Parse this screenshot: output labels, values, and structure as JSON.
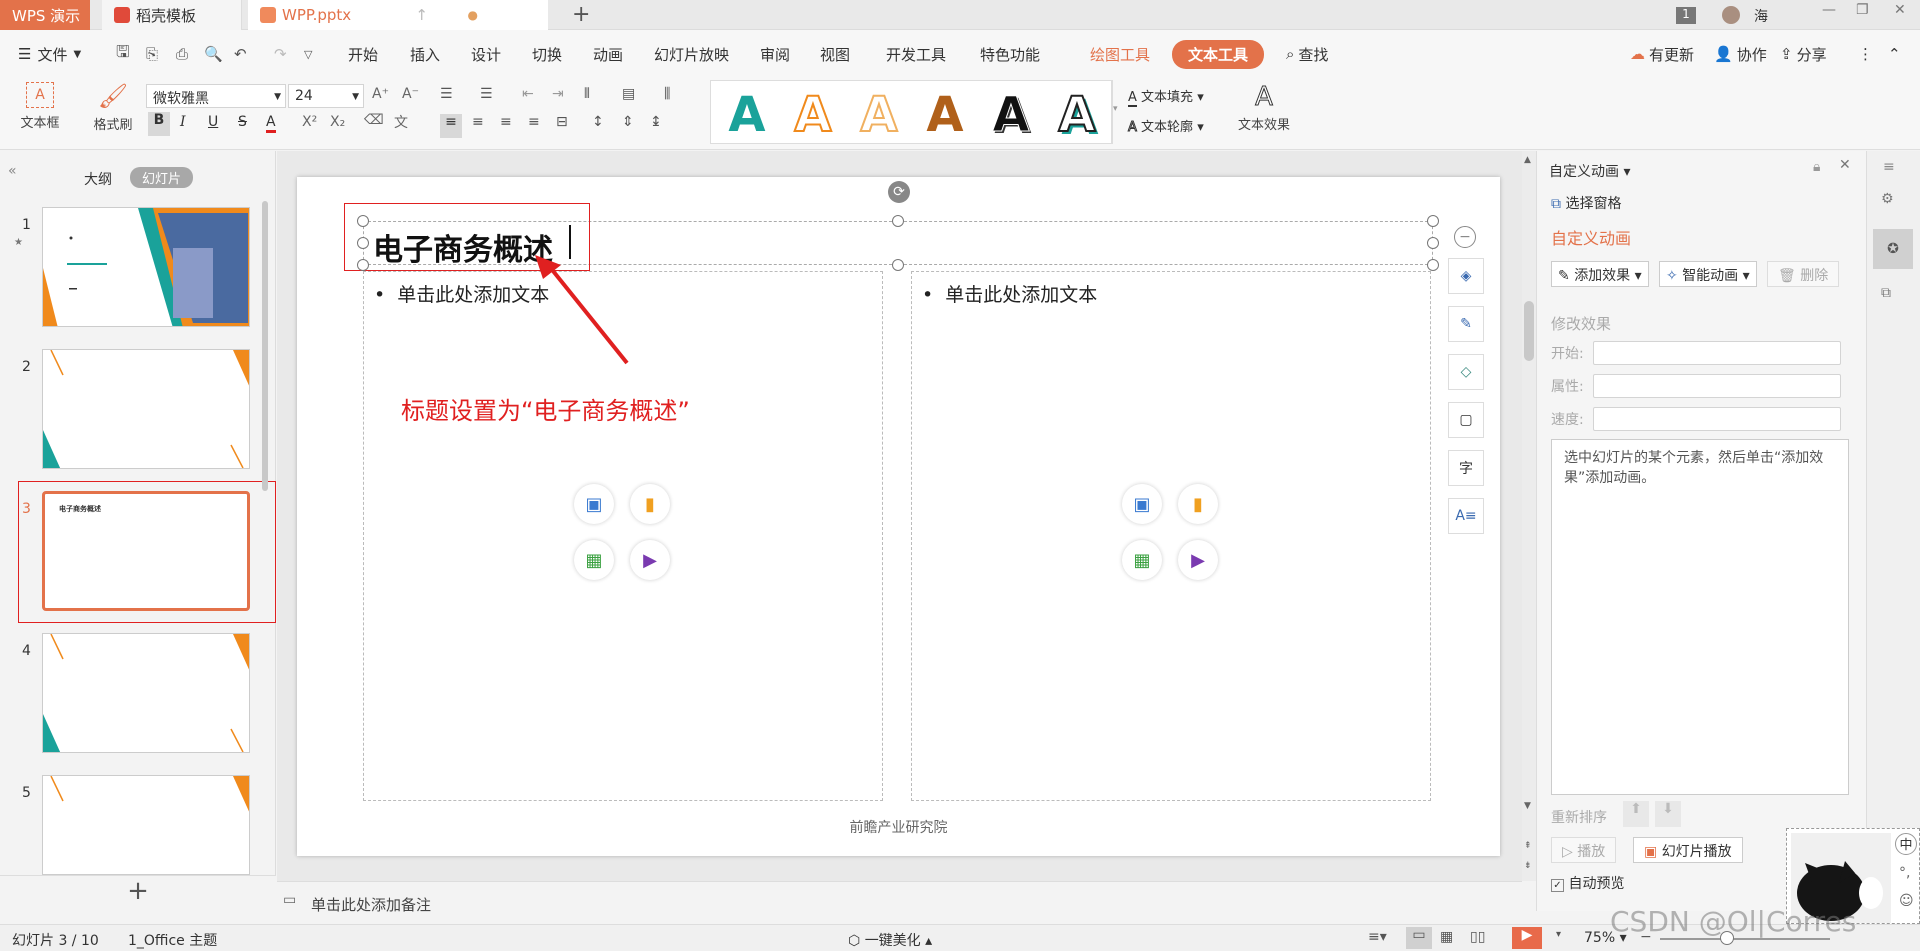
{
  "tabs": {
    "app": "WPS 演示",
    "template": "稻壳模板",
    "document": "WPP.pptx",
    "new_tab": "+"
  },
  "window": {
    "badge": "1",
    "user": "海"
  },
  "menu": {
    "file": "文件",
    "items": [
      "开始",
      "插入",
      "设计",
      "切换",
      "动画",
      "幻灯片放映",
      "审阅",
      "视图",
      "开发工具",
      "特色功能"
    ],
    "drawing_tools": "绘图工具",
    "text_tools": "文本工具",
    "search": "查找",
    "update": "有更新",
    "collab": "协作",
    "share": "分享"
  },
  "ribbon": {
    "textbox": "文本框",
    "format_painter": "格式刷",
    "font_name": "微软雅黑",
    "font_size": "24",
    "text_fill": "文本填充",
    "text_outline": "文本轮廓",
    "text_effect": "文本效果",
    "bold": "B",
    "italic": "I",
    "underline": "U",
    "strike": "S",
    "font_color": "A",
    "wordart_glyph": "A"
  },
  "left_pane": {
    "outline_tab": "大纲",
    "slides_tab": "幻灯片",
    "slides": [
      {
        "num": "1",
        "starred": true,
        "title": ""
      },
      {
        "num": "2",
        "title": ""
      },
      {
        "num": "3",
        "title": "电子商务概述"
      },
      {
        "num": "4",
        "title": ""
      },
      {
        "num": "5",
        "title": ""
      }
    ],
    "add": "+"
  },
  "slide": {
    "title": "电子商务概述",
    "left_placeholder": "单击此处添加文本",
    "right_placeholder": "单击此处添加文本",
    "footer": "前瞻产业研究院",
    "annotation": "标题设置为“电子商务概述”"
  },
  "notes": {
    "placeholder": "单击此处添加备注"
  },
  "right_pane": {
    "title": "自定义动画",
    "select_pane": "选择窗格",
    "section": "自定义动画",
    "add_effect": "添加效果",
    "smart_anim": "智能动画",
    "delete": "删除",
    "modify": "修改效果",
    "start": "开始:",
    "property": "属性:",
    "speed": "速度:",
    "hint": "选中幻灯片的某个元素，然后单击“添加效果”添加动画。",
    "reorder": "重新排序",
    "play": "播放",
    "slideshow": "幻灯片播放",
    "autopreview": "自动预览"
  },
  "status": {
    "slide_info": "幻灯片 3 / 10",
    "theme": "1_Office 主题",
    "beautify": "一键美化",
    "zoom": "75%",
    "watermark": "CSDN @Ol|Corres",
    "ime": "中"
  },
  "colors": {
    "accent": "#e3724a",
    "teal": "#1aa29a",
    "orange": "#f08a1c",
    "annotation_red": "#e02020"
  }
}
